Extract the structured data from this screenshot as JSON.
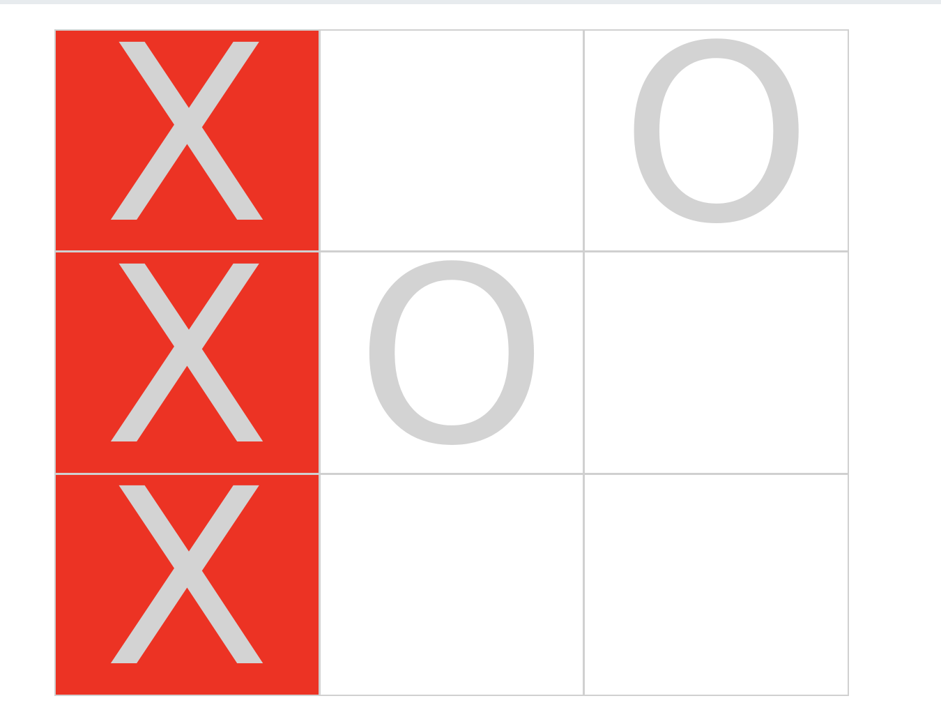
{
  "board": {
    "cells": [
      {
        "mark": "X",
        "winning": true
      },
      {
        "mark": "",
        "winning": false
      },
      {
        "mark": "O",
        "winning": false
      },
      {
        "mark": "X",
        "winning": true
      },
      {
        "mark": "O",
        "winning": false
      },
      {
        "mark": "",
        "winning": false
      },
      {
        "mark": "X",
        "winning": true
      },
      {
        "mark": "",
        "winning": false
      },
      {
        "mark": "",
        "winning": false
      }
    ]
  },
  "colors": {
    "win_highlight": "#ec3324",
    "mark": "#d3d3d3",
    "grid_line": "#d0d0d0",
    "cell_background": "#ffffff"
  }
}
